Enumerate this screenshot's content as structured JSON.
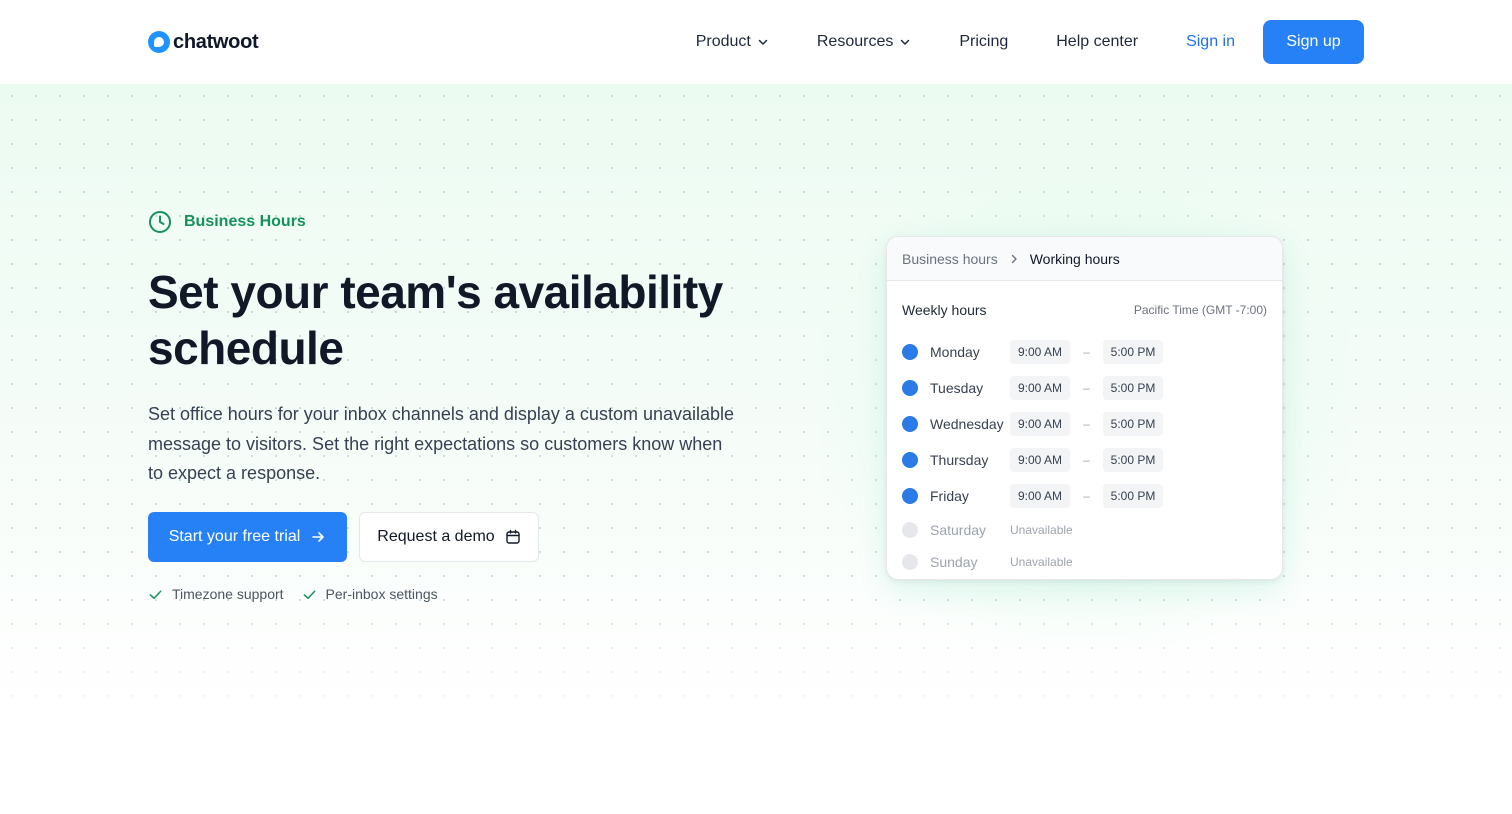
{
  "header": {
    "brand": "chatwoot",
    "nav": [
      {
        "label": "Product",
        "has_dropdown": true
      },
      {
        "label": "Resources",
        "has_dropdown": true
      },
      {
        "label": "Pricing",
        "has_dropdown": false
      },
      {
        "label": "Help center",
        "has_dropdown": false
      }
    ],
    "sign_in": "Sign in",
    "sign_up": "Sign up"
  },
  "hero": {
    "eyebrow": "Business Hours",
    "title": "Set your team's availability schedule",
    "description": "Set office hours for your inbox channels and display a custom unavailable message to visitors. Set the right expectations so customers know when to expect a response.",
    "cta_primary": "Start your free trial",
    "cta_secondary": "Request a demo",
    "features": [
      "Timezone support",
      "Per-inbox settings"
    ]
  },
  "card": {
    "breadcrumb": [
      "Business hours",
      "Working hours"
    ],
    "section_title": "Weekly hours",
    "timezone": "Pacific Time (GMT -7:00)",
    "separator": "–",
    "days": [
      {
        "name": "Monday",
        "enabled": true,
        "start": "9:00 AM",
        "end": "5:00 PM"
      },
      {
        "name": "Tuesday",
        "enabled": true,
        "start": "9:00 AM",
        "end": "5:00 PM"
      },
      {
        "name": "Wednesday",
        "enabled": true,
        "start": "9:00 AM",
        "end": "5:00 PM"
      },
      {
        "name": "Thursday",
        "enabled": true,
        "start": "9:00 AM",
        "end": "5:00 PM"
      },
      {
        "name": "Friday",
        "enabled": true,
        "start": "9:00 AM",
        "end": "5:00 PM"
      },
      {
        "name": "Saturday",
        "enabled": false,
        "status": "Unavailable"
      },
      {
        "name": "Sunday",
        "enabled": false,
        "status": "Unavailable"
      }
    ]
  },
  "colors": {
    "primary": "#2781f6",
    "accent_green": "#15925c",
    "day_on": "#2b7be6",
    "day_off": "#e5e7eb"
  },
  "icons": {
    "logo": "chatwoot-logo-icon",
    "eyebrow": "clock-icon",
    "cta_primary": "arrow-right-icon",
    "cta_secondary": "calendar-icon",
    "feature": "check-icon",
    "nav_dropdown": "chevron-down-icon",
    "breadcrumb_separator": "chevron-right-icon"
  }
}
